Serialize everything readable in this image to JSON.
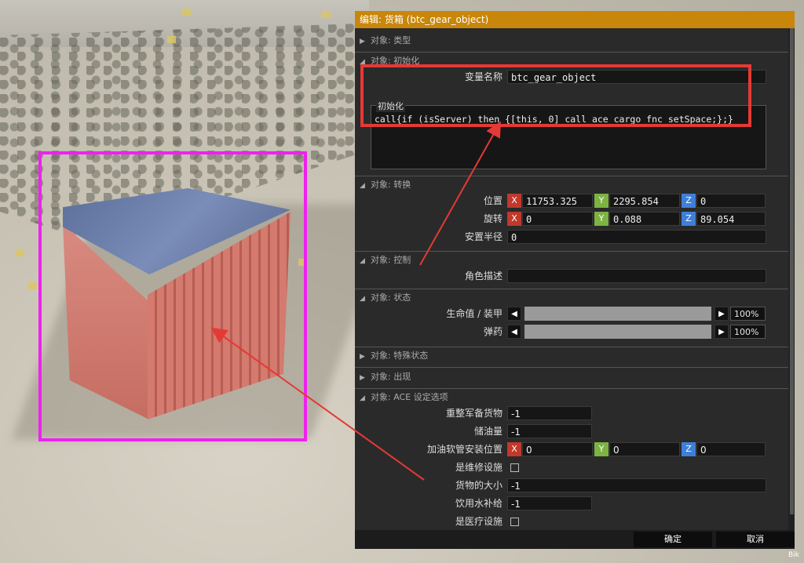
{
  "dialog": {
    "title": "编辑: 货箱 (btc_gear_object)",
    "confirm_label": "确定",
    "cancel_label": "取消"
  },
  "sections": {
    "type": "对象: 类型",
    "init": "对象: 初始化",
    "transform": "对象: 转换",
    "control": "对象: 控制",
    "state": "对象: 状态",
    "special": "对象: 特殊状态",
    "appear": "对象: 出现",
    "ace": "对象: ACE 设定选项"
  },
  "init": {
    "var_label": "变量名称",
    "var_value": "btc_gear_object",
    "init_label": "初始化",
    "init_code": "call{if (isServer) then {[this, 0] call ace_cargo_fnc_setSpace;};}"
  },
  "transform": {
    "position_label": "位置",
    "position": {
      "x": "11753.325",
      "y": "2295.854",
      "z": "0"
    },
    "rotation_label": "旋转",
    "rotation": {
      "x": "0",
      "y": "0.088",
      "z": "89.054"
    },
    "radius_label": "安置半径",
    "radius_value": "0",
    "axis_x": "X",
    "axis_y": "Y",
    "axis_z": "Z"
  },
  "control": {
    "role_label": "角色描述",
    "role_value": ""
  },
  "state": {
    "health_label": "生命值 / 装甲",
    "health_value": "100%",
    "health_fraction": 1.0,
    "ammo_label": "弹药",
    "ammo_value": "100%",
    "ammo_fraction": 1.0
  },
  "ace": {
    "rearm_label": "重整军备货物",
    "rearm_value": "-1",
    "fuel_label": "储油量",
    "fuel_value": "-1",
    "hose_label": "加油软管安装位置",
    "hose": {
      "x": "0",
      "y": "0",
      "z": "0"
    },
    "repair_label": "是维修设施",
    "repair_checked": false,
    "cargo_size_label": "货物的大小",
    "cargo_size_value": "-1",
    "water_label": "饮用水补给",
    "water_value": "-1",
    "medical_label": "是医疗设施",
    "medical_checked": false
  },
  "icons": {
    "collapsed": "triangle-right-icon",
    "expanded": "triangle-down-icon",
    "left": "arrow-left-icon",
    "right": "arrow-right-icon"
  },
  "colors": {
    "title_bar": "#c8860a",
    "axis_x": "#c0392b",
    "axis_y": "#7cb342",
    "axis_z": "#3f7fd9",
    "highlight_red": "#e53935",
    "highlight_magenta": "#f020f0"
  },
  "corner_text": "Bik"
}
